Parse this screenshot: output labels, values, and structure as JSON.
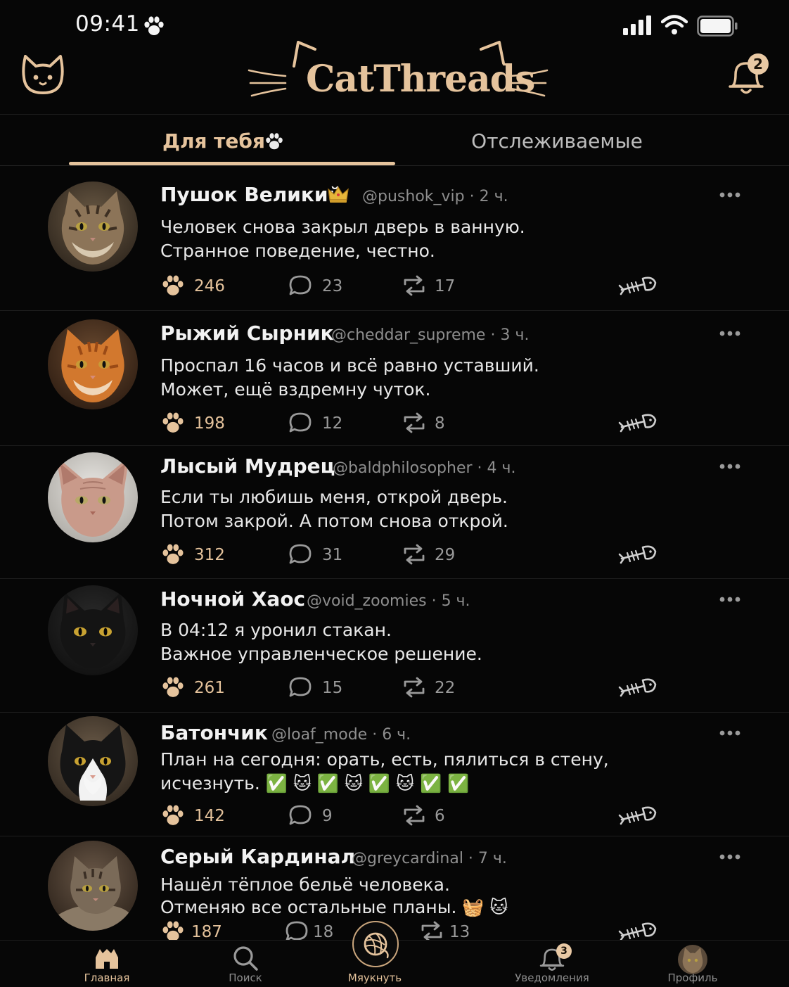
{
  "status_bar": {
    "time": "09:41",
    "icons": [
      "paw-icon",
      "signal-icon",
      "wifi-icon",
      "battery-icon"
    ]
  },
  "header": {
    "brand": "CatThreads",
    "notification_count": "2"
  },
  "tabs": {
    "for_you": "Для тебя",
    "following": "Отслеживаемые",
    "active": "for_you"
  },
  "colors": {
    "accent": "#e5c39c",
    "background": "#060606",
    "text": "#ececec",
    "muted": "#8e8e8e"
  },
  "posts": [
    {
      "name": "Пушок Великий",
      "badge": "crown",
      "handle": "@pushok_vip",
      "time": "2 ч.",
      "text_line1": "Человек снова закрыл дверь в ванную.",
      "text_line2": "Странное поведение, честно.",
      "likes": "246",
      "replies": "23",
      "reposts": "17",
      "avatar": "tabby-maine-coon"
    },
    {
      "name": "Рыжий Сырник",
      "handle": "@cheddar_supreme",
      "time": "3 ч.",
      "text_line1": "Проспал 16 часов и всё равно уставший.",
      "text_line2": "Может, ещё вздремну чуток.",
      "likes": "198",
      "replies": "12",
      "reposts": "8",
      "avatar": "orange-cat"
    },
    {
      "name": "Лысый Мудрец",
      "handle": "@baldphilosopher",
      "time": "4 ч.",
      "text_line1": "Если ты любишь меня, открой дверь.",
      "text_line2": "Потом закрой. А потом снова открой.",
      "likes": "312",
      "replies": "31",
      "reposts": "29",
      "avatar": "sphynx-cat"
    },
    {
      "name": "Ночной Хаос",
      "handle": "@void_zoomies",
      "time": "5 ч.",
      "text_line1": "В 04:12 я уронил стакан.",
      "text_line2": "Важное управленческое решение.",
      "likes": "261",
      "replies": "15",
      "reposts": "22",
      "avatar": "black-cat"
    },
    {
      "name": "Батончик",
      "handle": "@loaf_mode",
      "time": "6 ч.",
      "text_line1": "План на сегодня: орать, есть, пялиться в стену,",
      "text_line2": "исчезнуть. ✅ 🐱 ✅ 🐱 ✅ 🐱 ✅ ✅",
      "likes": "142",
      "replies": "9",
      "reposts": "6",
      "avatar": "tuxedo-cat"
    },
    {
      "name": "Серый Кардинал",
      "handle": "@greycardinal",
      "time": "7 ч.",
      "text_line1": "Нашёл тёплое бельё человека.",
      "text_line2": "Отменяю все остальные планы. 🧺 🐱",
      "likes": "187",
      "replies": "18",
      "reposts": "13",
      "avatar": "grey-tabby"
    }
  ],
  "bottom_nav": {
    "home": "Главная",
    "search": "Поиск",
    "meow": "Мяукнуть",
    "notifications": "Уведомления",
    "notifications_count": "3",
    "profile": "Профиль"
  }
}
